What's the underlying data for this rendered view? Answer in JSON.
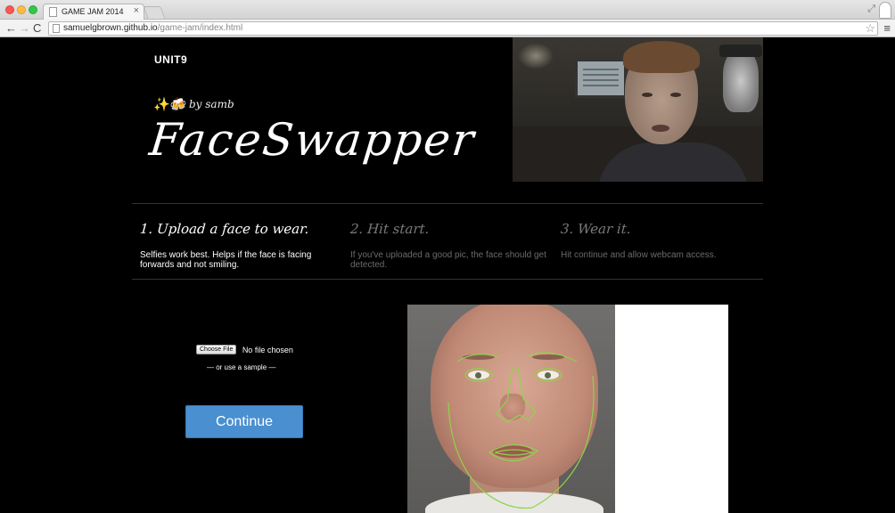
{
  "browser": {
    "tab_title": "GAME JAM 2014",
    "tab_close": "×",
    "url_host": "samuelgbrown.github.io",
    "url_path": "/game-jam/index.html",
    "back_icon": "←",
    "forward_icon": "→",
    "reload_icon": "C",
    "star_icon": "☆",
    "menu_icon": "≡",
    "resize_icon": "⤢"
  },
  "header": {
    "logo": "UNIT9",
    "sparkles": "✨🍻",
    "byline": "by samb",
    "title": "FaceSwapper"
  },
  "steps": [
    {
      "heading": "1. Upload a face to wear.",
      "description": "Selfies work best. Helps if the face is facing forwards and not smiling.",
      "active": true
    },
    {
      "heading": "2. Hit start.",
      "description": "If you've uploaded a good pic, the face should get detected.",
      "active": false
    },
    {
      "heading": "3. Wear it.",
      "description": "Hit continue and allow webcam access.",
      "active": false
    }
  ],
  "upload": {
    "choose_file_label": "Choose File",
    "no_file_text": "No file chosen",
    "sample_text": "— or use a sample —",
    "continue_label": "Continue"
  },
  "colors": {
    "background": "#000000",
    "continue_button": "#4a8fd0",
    "face_tracking_overlay": "#8fd44a",
    "inactive_step_text": "#7a7a7a"
  }
}
